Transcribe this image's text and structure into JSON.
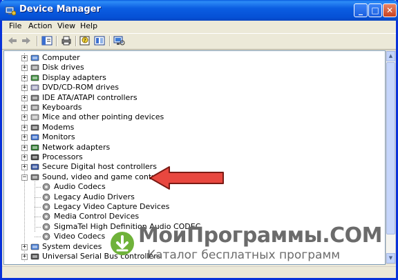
{
  "window": {
    "title": "Device Manager"
  },
  "title_buttons": {
    "minimize": "_",
    "maximize": "□",
    "close": "✕"
  },
  "menu": [
    {
      "label": "File"
    },
    {
      "label": "Action"
    },
    {
      "label": "View"
    },
    {
      "label": "Help"
    }
  ],
  "toolbar": {
    "icons": [
      "back-arrow-icon",
      "forward-arrow-icon",
      "properties-icon",
      "print-icon",
      "help-icon",
      "view-icon",
      "scan-hardware-icon"
    ]
  },
  "tree": {
    "categories": [
      {
        "label": "Computer",
        "icon": "computer-icon",
        "expanded": false
      },
      {
        "label": "Disk drives",
        "icon": "disk-drive-icon",
        "expanded": false
      },
      {
        "label": "Display adapters",
        "icon": "display-adapter-icon",
        "expanded": false
      },
      {
        "label": "DVD/CD-ROM drives",
        "icon": "dvd-drive-icon",
        "expanded": false
      },
      {
        "label": "IDE ATA/ATAPI controllers",
        "icon": "ide-controller-icon",
        "expanded": false
      },
      {
        "label": "Keyboards",
        "icon": "keyboard-icon",
        "expanded": false
      },
      {
        "label": "Mice and other pointing devices",
        "icon": "mouse-icon",
        "expanded": false
      },
      {
        "label": "Modems",
        "icon": "modem-icon",
        "expanded": false
      },
      {
        "label": "Monitors",
        "icon": "monitor-icon",
        "expanded": false
      },
      {
        "label": "Network adapters",
        "icon": "network-adapter-icon",
        "expanded": false
      },
      {
        "label": "Processors",
        "icon": "processor-icon",
        "expanded": false
      },
      {
        "label": "Secure Digital host controllers",
        "icon": "sd-controller-icon",
        "expanded": false
      },
      {
        "label": "Sound, video and game controllers",
        "icon": "sound-icon",
        "expanded": true,
        "children": [
          {
            "label": "Audio Codecs"
          },
          {
            "label": "Legacy Audio Drivers"
          },
          {
            "label": "Legacy Video Capture Devices"
          },
          {
            "label": "Media Control Devices"
          },
          {
            "label": "SigmaTel High Definition Audio CODEC"
          },
          {
            "label": "Video Codecs"
          }
        ]
      },
      {
        "label": "System devices",
        "icon": "system-devices-icon",
        "expanded": false
      },
      {
        "label": "Universal Serial Bus controllers",
        "icon": "usb-icon",
        "expanded": false
      }
    ]
  },
  "expander": {
    "collapsed": "+",
    "expanded": "−"
  },
  "watermark": {
    "line1": "МоиПрограммы.COM",
    "line2": "Каталог бесплатных программ"
  },
  "colors": {
    "titlebar": "#0a5ddf",
    "annotation_arrow": "#e8473f",
    "watermark_badge": "#6fb23a"
  }
}
